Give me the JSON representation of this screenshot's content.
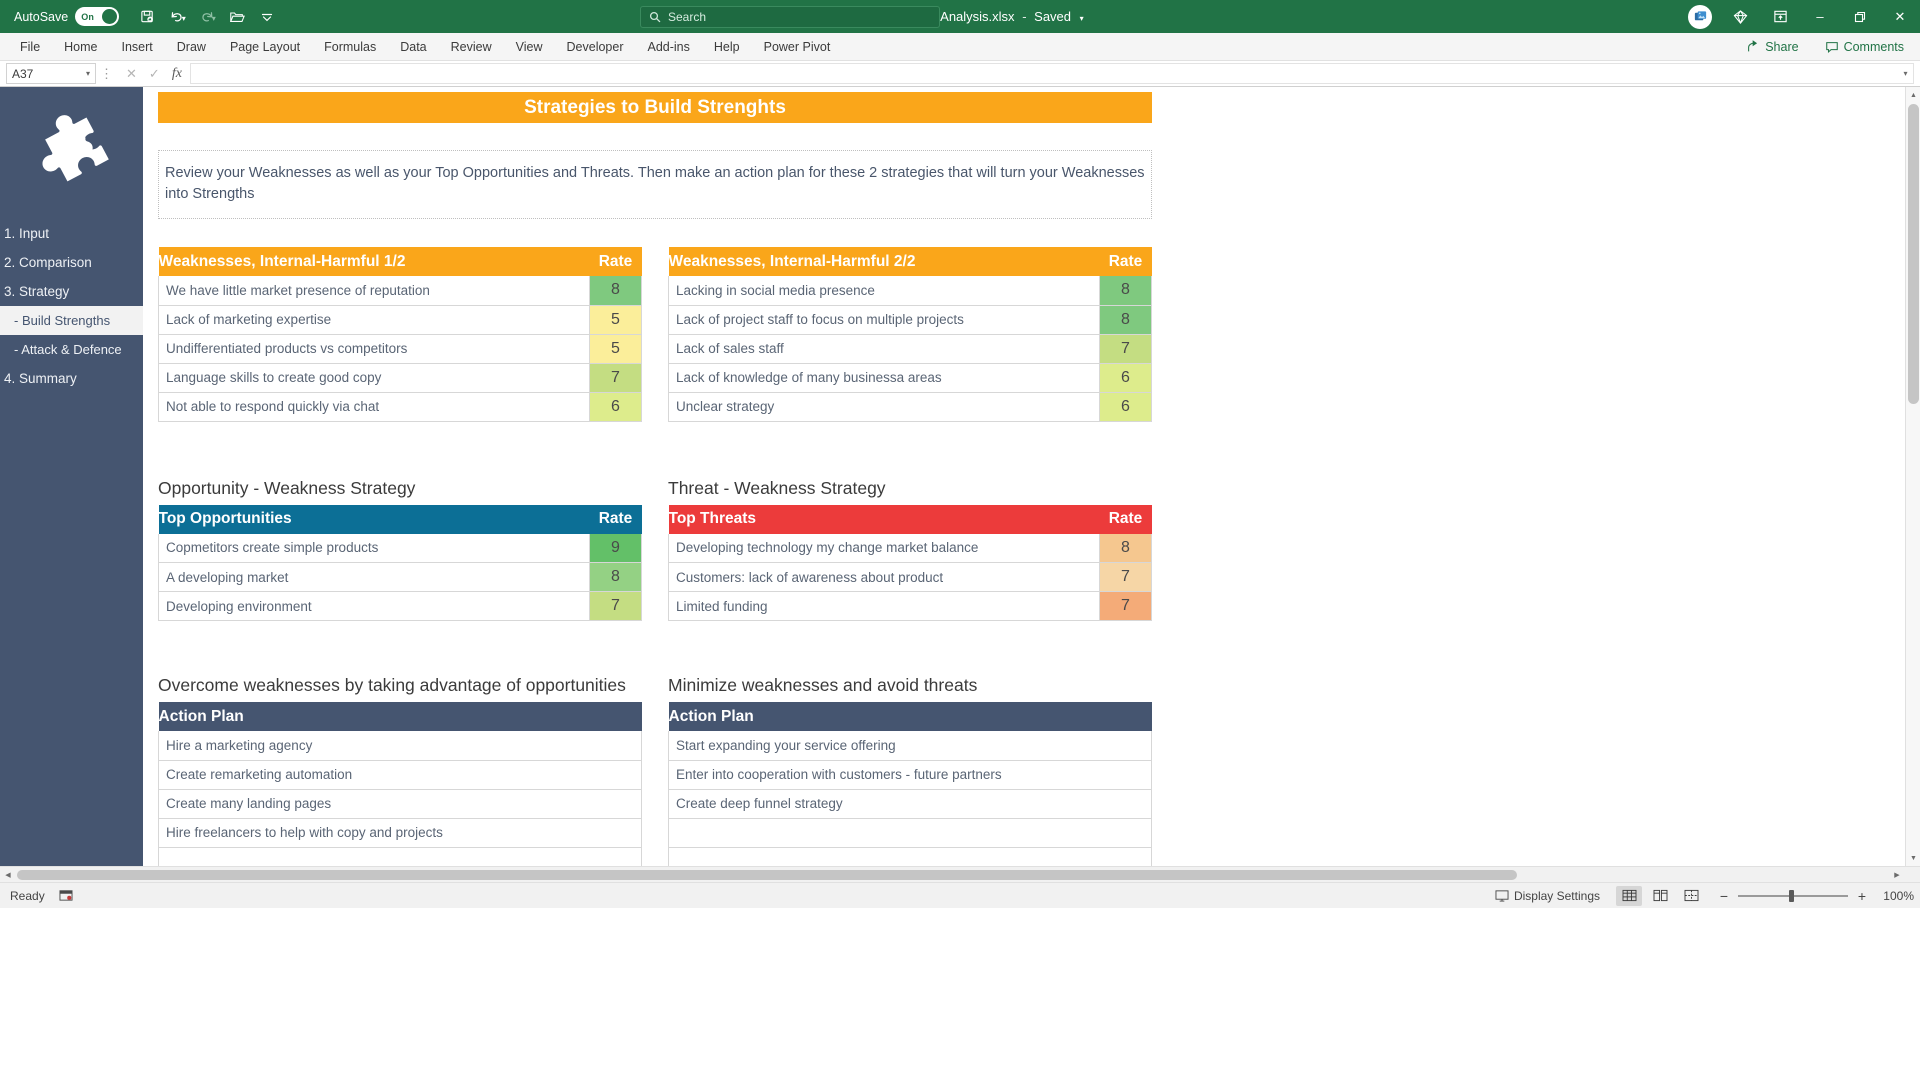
{
  "titlebar": {
    "autosave_label": "AutoSave",
    "autosave_state": "On",
    "document_title": "Enhanced SWOT Analysis.xlsx",
    "save_state": "Saved",
    "separator": "-",
    "search_placeholder": "Search",
    "quick_access": [
      {
        "name": "save-icon",
        "glyph": "὚B"
      },
      {
        "name": "undo-icon",
        "glyph": "↶"
      },
      {
        "name": "redo-icon",
        "glyph": "↷"
      },
      {
        "name": "open-folder-icon",
        "glyph": "὜1"
      },
      {
        "name": "customize-quick-access-icon",
        "glyph": "⌄"
      }
    ],
    "window_controls": {
      "minimize": "–",
      "restore": "❐",
      "close": "✕"
    }
  },
  "ribbon": {
    "tabs": [
      "File",
      "Home",
      "Insert",
      "Draw",
      "Page Layout",
      "Formulas",
      "Data",
      "Review",
      "View",
      "Developer",
      "Add-ins",
      "Help",
      "Power Pivot"
    ],
    "share_label": "Share",
    "comments_label": "Comments"
  },
  "formula_bar": {
    "name_box_value": "A37",
    "formula_value": "",
    "cancel_icon": "✕",
    "enter_icon": "✓",
    "function_icon": "fx"
  },
  "sidebar": {
    "logo": "puzzle-piece-logo",
    "items": [
      {
        "label": "1. Input",
        "sub": false,
        "active": false
      },
      {
        "label": "2. Comparison",
        "sub": false,
        "active": false
      },
      {
        "label": "3. Strategy",
        "sub": false,
        "active": false
      },
      {
        "label": "- Build Strengths",
        "sub": true,
        "active": true
      },
      {
        "label": "- Attack & Defence",
        "sub": true,
        "active": false
      },
      {
        "label": "4. Summary",
        "sub": false,
        "active": false
      }
    ]
  },
  "sheet": {
    "banner_title": "Strategies to Build Strenghts",
    "intro_text": "Review your Weaknesses as well as your Top Opportunities and Threats. Then make an action plan for these 2 strategies that will turn your Weaknesses into Strengths",
    "rate_header": "Rate",
    "weaknesses_left": {
      "header": "Weaknesses, Internal-Harmful 1/2",
      "rows": [
        {
          "item": "We have little market presence of reputation",
          "rate": "8",
          "color": "#7fc97f"
        },
        {
          "item": "Lack of marketing expertise",
          "rate": "5",
          "color": "#fbee9a"
        },
        {
          "item": "Undifferentiated products vs competitors",
          "rate": "5",
          "color": "#fbee9a"
        },
        {
          "item": "Language skills to create good copy",
          "rate": "7",
          "color": "#c4dd82"
        },
        {
          "item": "Not able to respond quickly via chat",
          "rate": "6",
          "color": "#ddec8c"
        }
      ]
    },
    "weaknesses_right": {
      "header": "Weaknesses, Internal-Harmful 2/2",
      "rows": [
        {
          "item": "Lacking in social media presence",
          "rate": "8",
          "color": "#7fc97f"
        },
        {
          "item": "Lack of project staff to focus on multiple projects",
          "rate": "8",
          "color": "#7fc97f"
        },
        {
          "item": "Lack of sales staff",
          "rate": "7",
          "color": "#c4dd82"
        },
        {
          "item": "Lack of knowledge of many businessa areas",
          "rate": "6",
          "color": "#ddec8c"
        },
        {
          "item": "Unclear strategy",
          "rate": "6",
          "color": "#ddec8c"
        }
      ]
    },
    "opportunity_strategy": {
      "section_title": "Opportunity - Weakness Strategy",
      "header": "Top Opportunities",
      "rows": [
        {
          "item": "Copmetitors create simple products",
          "rate": "9",
          "color": "#63c068"
        },
        {
          "item": "A developing market",
          "rate": "8",
          "color": "#94d184"
        },
        {
          "item": "Developing environment",
          "rate": "7",
          "color": "#c4dd82"
        }
      ]
    },
    "threat_strategy": {
      "section_title": "Threat - Weakness Strategy",
      "header": "Top Threats",
      "rows": [
        {
          "item": "Developing technology my change market balance",
          "rate": "8",
          "color": "#f5c78f"
        },
        {
          "item": "Customers: lack of awareness about product",
          "rate": "7",
          "color": "#f6d6a6"
        },
        {
          "item": "Limited funding",
          "rate": "7",
          "color": "#f4ab78"
        }
      ]
    },
    "action_plan_left": {
      "section_title": "Overcome weaknesses by taking advantage of opportunities",
      "header": "Action Plan",
      "rows": [
        "Hire a marketing agency",
        "Create remarketing automation",
        "Create many landing pages",
        "Hire freelancers to help with copy and projects",
        ""
      ]
    },
    "action_plan_right": {
      "section_title": "Minimize weaknesses and avoid threats",
      "header": "Action Plan",
      "rows": [
        "Start expanding your service offering",
        "Enter into cooperation with customers - future partners",
        "Create deep funnel strategy",
        "",
        ""
      ]
    }
  },
  "statusbar": {
    "status": "Ready",
    "macro_icon": "record-macro-icon",
    "display_settings": "Display Settings",
    "views": [
      "normal-view-icon",
      "page-layout-view-icon",
      "page-break-view-icon"
    ],
    "zoom_out": "−",
    "zoom_in": "+",
    "zoom_level": "100%"
  },
  "colors": {
    "excel_green": "#217346",
    "sidebar_navy": "#455570",
    "accent_orange": "#faa61a",
    "accent_blue": "#0c6f96",
    "accent_red": "#ec3b3b",
    "header_dark": "#455570"
  }
}
